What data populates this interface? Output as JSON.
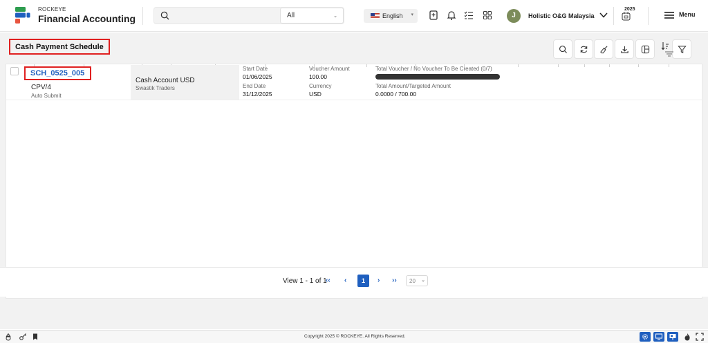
{
  "header": {
    "brand_small": "ROCKEYE",
    "brand_title": "Financial Accounting",
    "search_placeholder": "",
    "search_scope": "All",
    "language": "English",
    "user_initial": "J",
    "company": "Holistic O&G Malaysia",
    "fiscal_year": "2025",
    "menu_label": "Menu",
    "icons": [
      "search-icon",
      "bookmark-icon",
      "bell-icon",
      "checklist-icon",
      "grid-icon",
      "chevron-down-icon",
      "calendar-icon",
      "hamburger-icon"
    ]
  },
  "page": {
    "title": "Cash Payment Schedule",
    "toolbar_icons": [
      "search-icon",
      "refresh-icon",
      "clear-icon",
      "download-icon",
      "columns-icon",
      "sort-icon",
      "filter-icon"
    ]
  },
  "rows": [
    {
      "schedule_id": "SCH_0525_005",
      "voucher_type": "CPV/4",
      "mode": "Auto Submit",
      "account": "Cash Account USD",
      "party": "Swastik Traders",
      "start_date_label": "Start Date",
      "start_date": "01/06/2025",
      "end_date_label": "End Date",
      "end_date": "31/12/2025",
      "voucher_amount_label": "Voucher Amount",
      "voucher_amount": "100.00",
      "currency_label": "Currency",
      "currency": "USD",
      "voucher_count_label": "Total Voucher / No Voucher To Be Created (0/7)",
      "voucher_progress": 0,
      "amount_label": "Total Amount/Targeted Amount",
      "amount_value": "0.0000 / 700.00"
    }
  ],
  "pagination": {
    "view_text": "View 1 - 1 of 1",
    "first": "‹‹",
    "prev": "‹",
    "current_page": "1",
    "next": "›",
    "last": "››",
    "page_size": "20"
  },
  "footer": {
    "copyright": "Copyright 2025 © ROCKEYE. All Rights Reserved."
  },
  "colors": {
    "accent": "#1f5fbf",
    "highlight_border": "#e02020",
    "avatar": "#7c8c5a"
  }
}
